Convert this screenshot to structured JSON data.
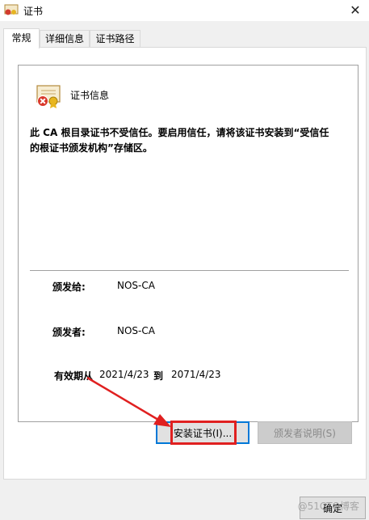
{
  "window": {
    "title": "证书",
    "close_glyph": "✕"
  },
  "tabs": [
    {
      "label": "常规"
    },
    {
      "label": "详细信息"
    },
    {
      "label": "证书路径"
    }
  ],
  "cert": {
    "icon": "certificate-error-icon",
    "header": "证书信息",
    "message": "此 CA 根目录证书不受信任。要启用信任，请将该证书安装到“受信任的根证书颁发机构”存储区。",
    "issued_to_label": "颁发给:",
    "issued_to_value": "NOS-CA",
    "issued_by_label": "颁发者:",
    "issued_by_value": "NOS-CA",
    "validity_label": "有效期从",
    "valid_from": "2021/4/23",
    "to_label": "到",
    "valid_to": "2071/4/23"
  },
  "buttons": {
    "install": "安装证书(I)...",
    "issuer_statement": "颁发者说明(S)",
    "ok": "确定"
  },
  "watermark": "@51CTO博客",
  "colors": {
    "highlight": "#e02020",
    "accent": "#0078d7"
  }
}
